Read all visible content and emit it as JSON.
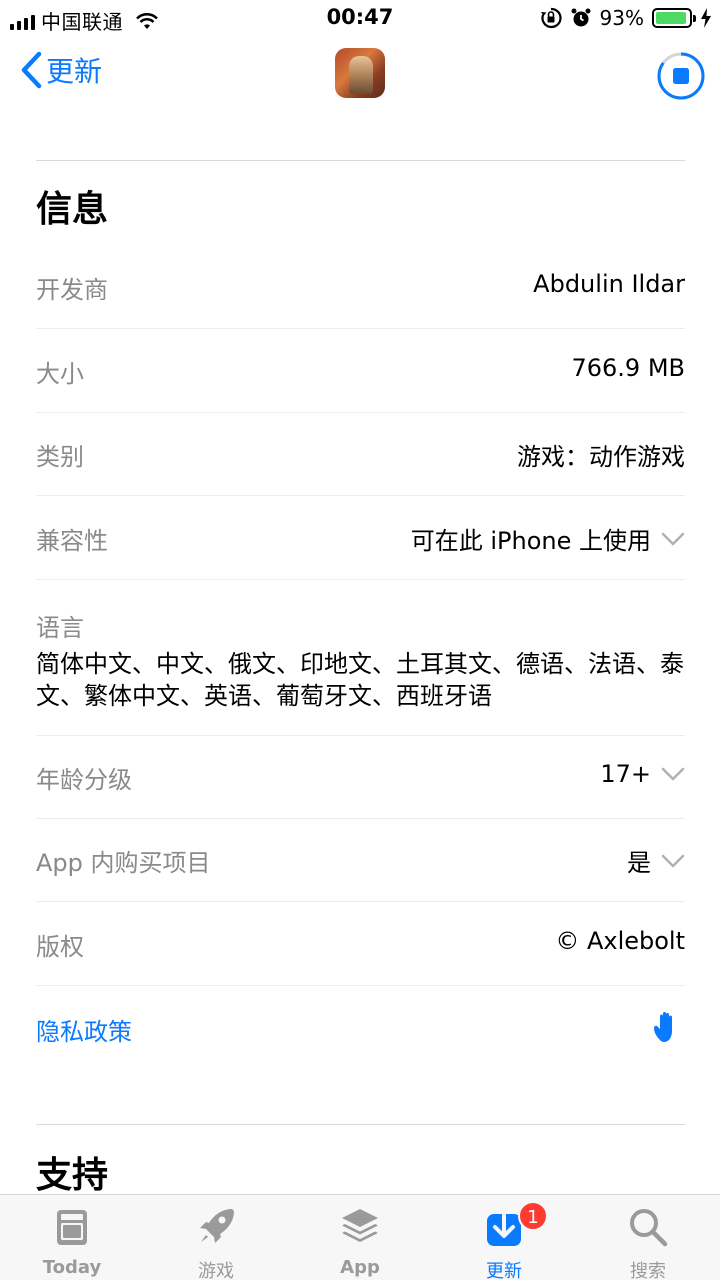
{
  "status_bar": {
    "carrier": "中国联通",
    "time": "00:47",
    "battery_percent": "93%",
    "battery_level": 0.93,
    "icons": [
      "signal-icon",
      "wifi-icon",
      "orientation-lock-icon",
      "alarm-icon",
      "battery-icon",
      "charging-icon"
    ]
  },
  "nav": {
    "back_label": "更新",
    "progress_icon": "download-stop-icon",
    "download_progress": 0.85
  },
  "info": {
    "title": "信息",
    "developer": {
      "label": "开发商",
      "value": "Abdulin Ildar"
    },
    "size": {
      "label": "大小",
      "value": "766.9 MB"
    },
    "category": {
      "label": "类别",
      "value": "游戏：动作游戏"
    },
    "compatibility": {
      "label": "兼容性",
      "value": "可在此 iPhone 上使用"
    },
    "languages": {
      "label": "语言",
      "value": "简体中文、中文、俄文、印地文、土耳其文、德语、法语、泰文、繁体中文、英语、葡萄牙文、西班牙语"
    },
    "age_rating": {
      "label": "年龄分级",
      "value": "17+"
    },
    "in_app_purchase": {
      "label": "App 内购买项目",
      "value": "是"
    },
    "copyright": {
      "label": "版权",
      "value": "© Axlebolt"
    },
    "privacy": {
      "label": "隐私政策"
    }
  },
  "support": {
    "title": "支持"
  },
  "tabbar": {
    "tabs": [
      {
        "label": "Today",
        "icon": "today-icon"
      },
      {
        "label": "游戏",
        "icon": "rocket-icon"
      },
      {
        "label": "App",
        "icon": "layers-icon"
      },
      {
        "label": "更新",
        "icon": "updates-icon",
        "badge": "1",
        "active": true
      },
      {
        "label": "搜索",
        "icon": "search-icon"
      }
    ]
  },
  "colors": {
    "accent": "#0a7aff",
    "badge": "#ff3b30",
    "battery": "#4cd964",
    "secondary_text": "#8a8a8e"
  }
}
